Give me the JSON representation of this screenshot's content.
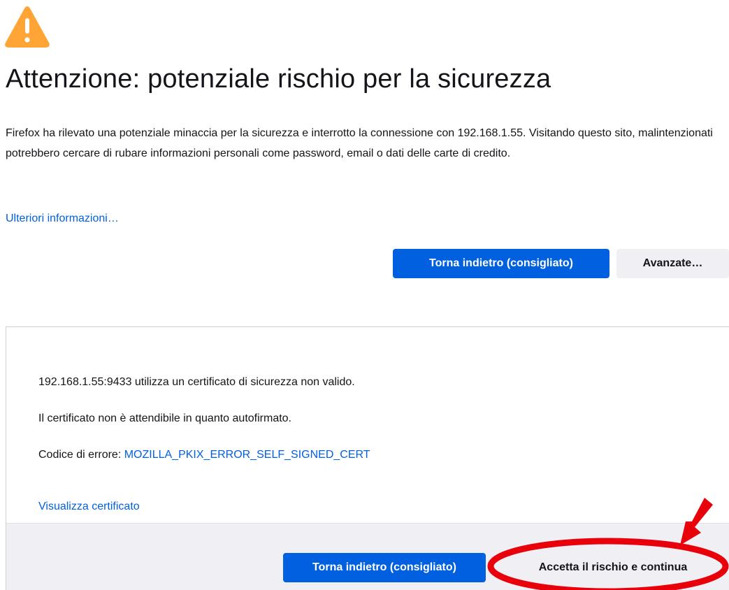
{
  "warning": {
    "icon": "warning-triangle-icon",
    "icon_color": "#ffa436",
    "title": "Attenzione: potenziale rischio per la sicurezza",
    "description": "Firefox ha rilevato una potenziale minaccia per la sicurezza e interrotto la connessione con 192.168.1.55. Visitando questo sito, malintenzionati potrebbero cercare di rubare informazioni personali come password, email o dati delle carte di credito.",
    "learn_more_link": "Ulteriori informazioni…"
  },
  "buttons": {
    "go_back_label": "Torna indietro (consigliato)",
    "advanced_label": "Avanzate…"
  },
  "advanced": {
    "invalid_cert_text": "192.168.1.55:9433 utilizza un certificato di sicurezza non valido.",
    "untrusted_text": "Il certificato non è attendibile in quanto autofirmato.",
    "error_code_prefix": "Codice di errore: ",
    "error_code": "MOZILLA_PKIX_ERROR_SELF_SIGNED_CERT",
    "view_certificate_link": "Visualizza certificato",
    "go_back_label": "Torna indietro (consigliato)",
    "accept_label": "Accetta il rischio e continua"
  },
  "colors": {
    "primary_button": "#0060df",
    "link": "#0060df",
    "secondary_button": "#f0f0f4",
    "annotation_red": "#e8000b"
  }
}
